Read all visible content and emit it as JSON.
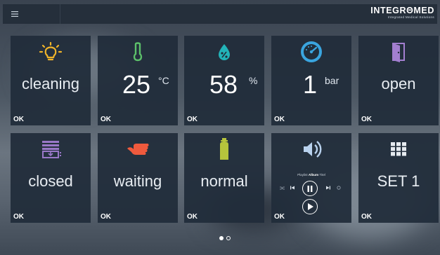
{
  "header": {
    "menu_icon": "hamburger-menu-icon",
    "brand": "INTEGRΘMED",
    "brand_subtitle": "Integrated Medical Solutions"
  },
  "colors": {
    "topbar": "#252f3b",
    "tile": "#212d3a",
    "lightbulb": "#f0b42a",
    "thermometer": "#5cc06a",
    "humidity": "#22b3b8",
    "gauge": "#3aa5df",
    "door": "#a37fd0",
    "drawer": "#9a78c8",
    "hand": "#ef5a3d",
    "bottle": "#b6c43c",
    "speaker": "#b9d2ee",
    "grid": "#e6ebf0"
  },
  "tiles": [
    {
      "name": "cleaning-tile",
      "icon": "lightbulb-icon",
      "label": "cleaning",
      "status": "OK"
    },
    {
      "name": "temperature-tile",
      "icon": "thermometer-icon",
      "value": "25",
      "unit": "°C",
      "status": "OK"
    },
    {
      "name": "humidity-tile",
      "icon": "humidity-drop-icon",
      "value": "58",
      "unit": "%",
      "status": "OK"
    },
    {
      "name": "pressure-tile",
      "icon": "gauge-icon",
      "value": "1",
      "unit": "bar",
      "status": "OK"
    },
    {
      "name": "door-tile",
      "icon": "door-icon",
      "label": "open",
      "status": "OK"
    },
    {
      "name": "drawer-tile",
      "icon": "drawer-icon",
      "label": "closed",
      "status": "OK"
    },
    {
      "name": "hand-tile",
      "icon": "hand-icon",
      "label": "waiting",
      "status": "OK"
    },
    {
      "name": "gas-tile",
      "icon": "gas-bottle-icon",
      "label": "normal",
      "status": "OK"
    },
    {
      "name": "player-tile",
      "icon": "speaker-icon",
      "playlist_text": "Playlist",
      "album_text": "Album",
      "title_text": "Titel",
      "status": "OK"
    },
    {
      "name": "set-tile",
      "icon": "grid-icon",
      "label": "SET 1",
      "status": "OK"
    }
  ],
  "pager": {
    "pages": 2,
    "active": 1
  }
}
